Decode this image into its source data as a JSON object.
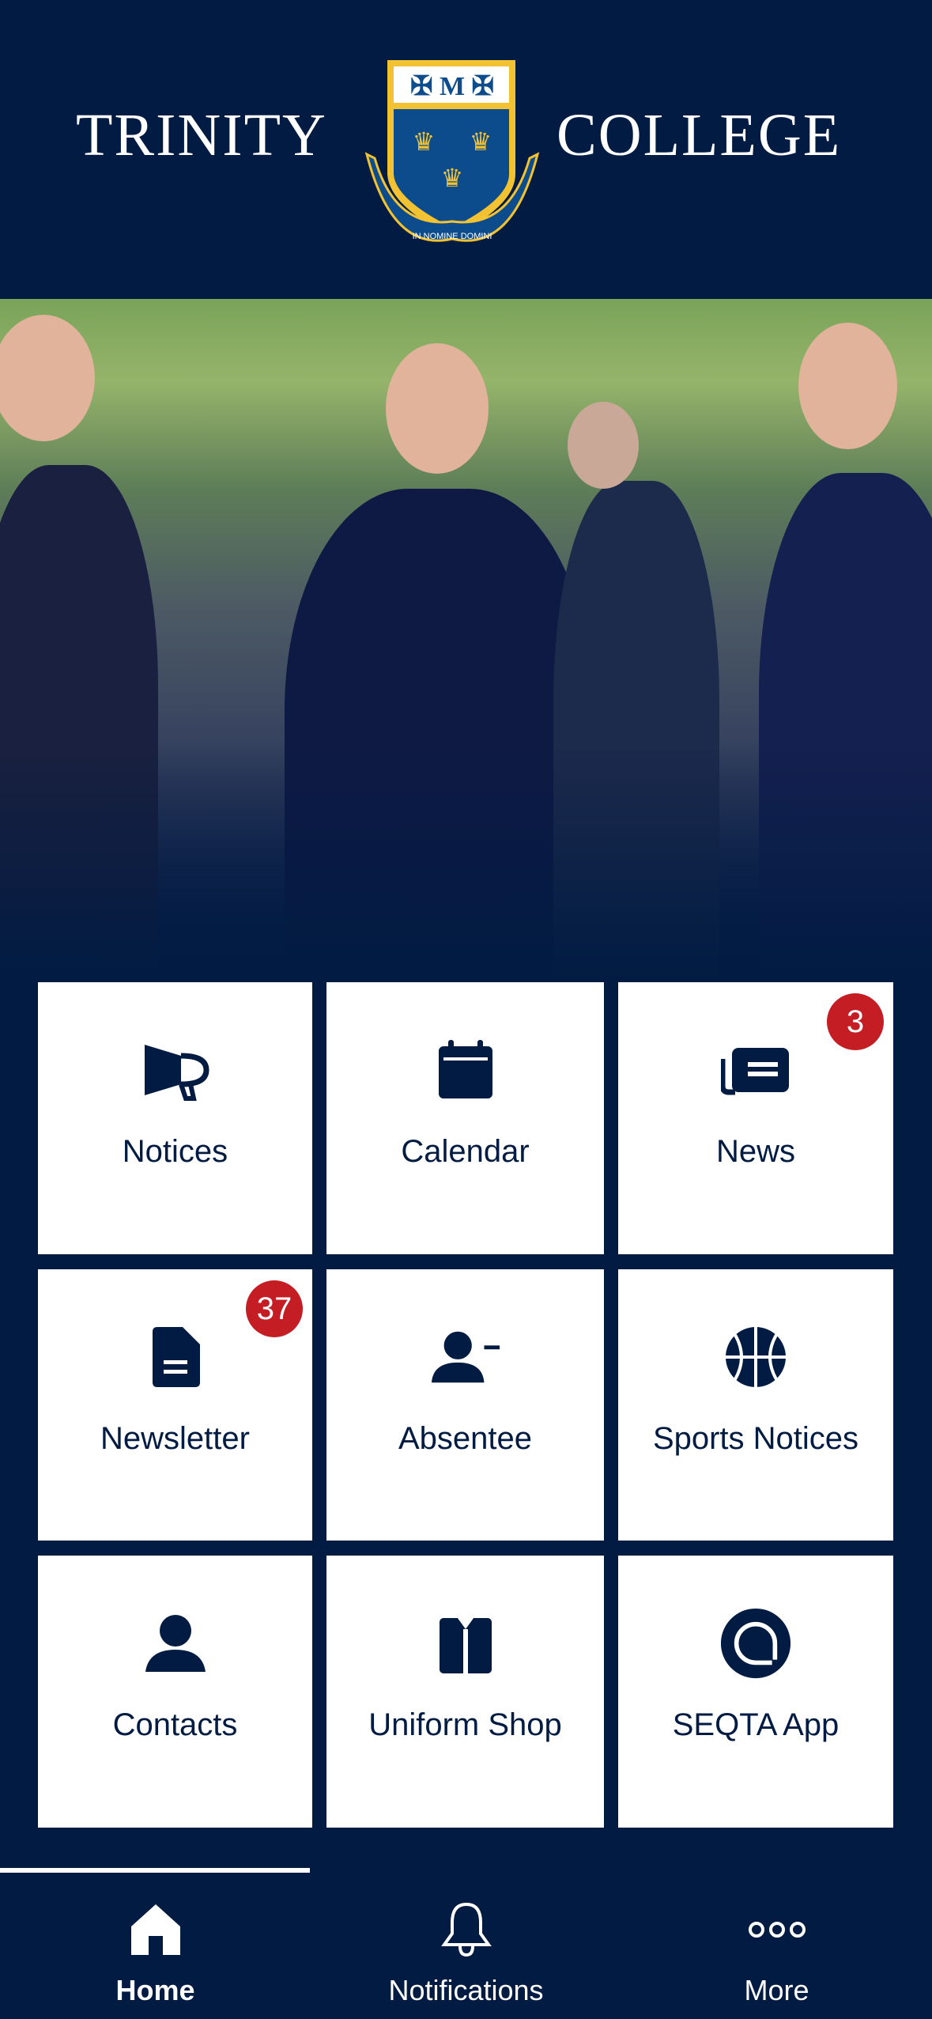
{
  "header": {
    "title_left": "TRINITY",
    "title_right": "COLLEGE",
    "crest_motto": "IN NOMINE DOMINI"
  },
  "colors": {
    "navy": "#011b42",
    "gold": "#f2c232",
    "badge_red": "#c41e24",
    "crest_blue": "#0d4c8c"
  },
  "tiles": [
    {
      "label": "Notices",
      "icon": "megaphone-icon"
    },
    {
      "label": "Calendar",
      "icon": "calendar-icon"
    },
    {
      "label": "News",
      "icon": "newspaper-icon",
      "badge": "3"
    },
    {
      "label": "Newsletter",
      "icon": "document-icon",
      "badge": "37"
    },
    {
      "label": "Absentee",
      "icon": "user-minus-icon"
    },
    {
      "label": "Sports Notices",
      "icon": "basketball-icon"
    },
    {
      "label": "Contacts",
      "icon": "person-icon"
    },
    {
      "label": "Uniform Shop",
      "icon": "shirt-icon"
    },
    {
      "label": "SEQTA App",
      "icon": "seqta-logo-icon"
    }
  ],
  "tabbar": {
    "active": "Home",
    "items": [
      {
        "label": "Home",
        "icon": "home-icon"
      },
      {
        "label": "Notifications",
        "icon": "bell-icon"
      },
      {
        "label": "More",
        "icon": "more-icon"
      }
    ]
  }
}
